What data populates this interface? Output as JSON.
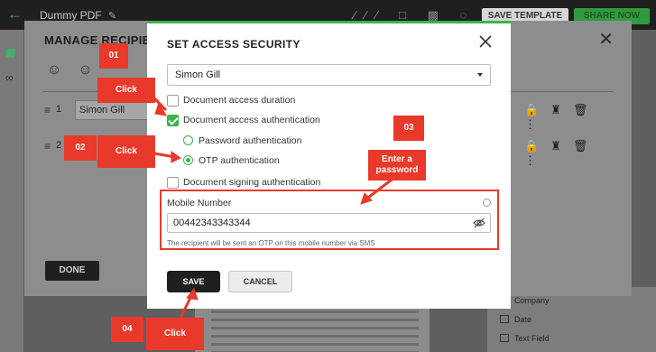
{
  "app": {
    "document_title": "Dummy PDF",
    "save_template_label": "SAVE TEMPLATE",
    "share_now_label": "SHARE NOW"
  },
  "manage_recipients": {
    "title": "MANAGE RECIPIENT",
    "rows": [
      {
        "number": "1",
        "name": "Simon Gill"
      },
      {
        "number": "2",
        "name": ""
      }
    ],
    "done_label": "DONE"
  },
  "fields_panel": {
    "items": [
      "Company",
      "Date",
      "Text Field"
    ]
  },
  "modal": {
    "title": "SET ACCESS SECURITY",
    "recipient_selected": "Simon Gill",
    "options": {
      "access_duration": "Document access duration",
      "access_authentication": "Document access authentication",
      "password_auth": "Password authentication",
      "otp_auth": "OTP authentication",
      "signing_authentication": "Document signing authentication"
    },
    "mobile": {
      "label": "Mobile Number",
      "value": "00442343343344",
      "hint": "The recipient will be sent an OTP on this mobile number via SMS"
    },
    "save_label": "SAVE",
    "cancel_label": "CANCEL"
  },
  "annotations": {
    "step1": "01",
    "step2": "02",
    "step3": "03",
    "step4": "04",
    "click1": "Click",
    "click2": "Click",
    "enter_password": "Enter a password",
    "click4": "Click"
  },
  "colors": {
    "accent": "#3bb54a",
    "annotation": "#e8392b",
    "primary_button": "#1f1f1f"
  }
}
